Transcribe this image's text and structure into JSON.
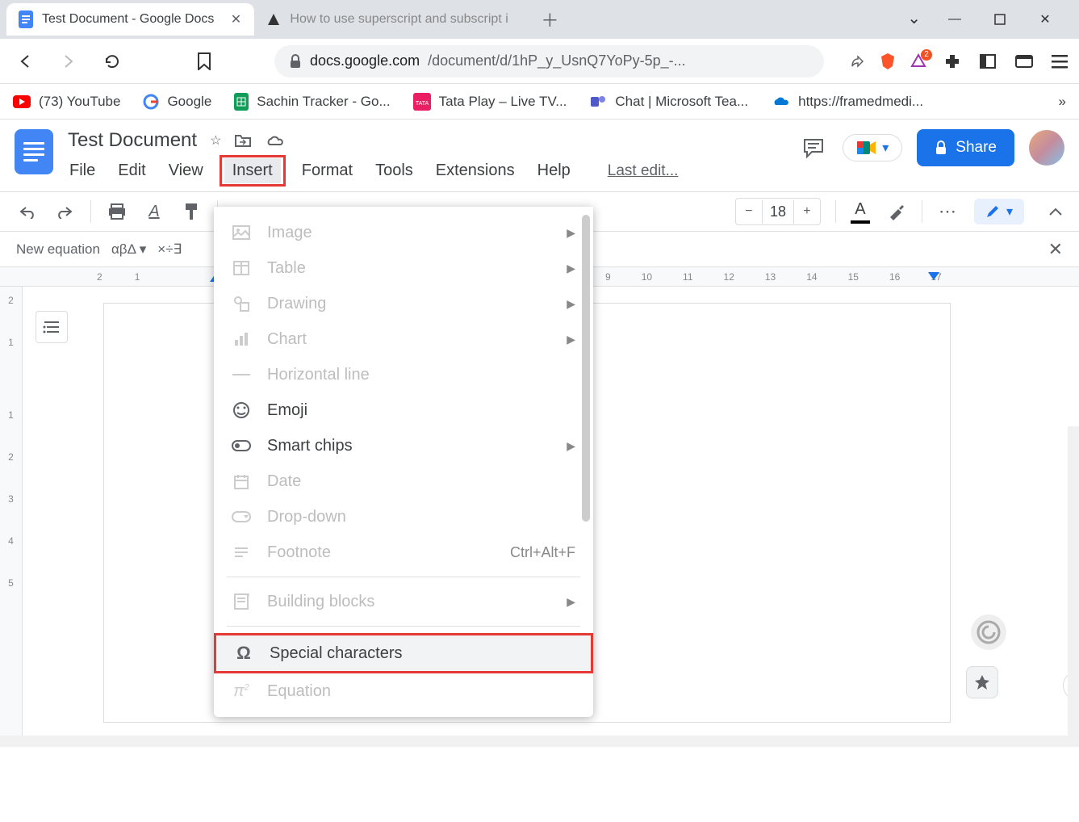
{
  "browser": {
    "tabs": [
      {
        "title": "Test Document - Google Docs",
        "active": true
      },
      {
        "title": "How to use superscript and subscript i",
        "active": false
      }
    ],
    "window_controls": {
      "minimize": "—",
      "maximize": "▢",
      "close": "✕"
    },
    "nav": {
      "back": "◁",
      "forward": "▷",
      "reload": "↻",
      "bookmark": "☆"
    },
    "url_lock": "🔒",
    "url_host": "docs.google.com",
    "url_path": "/document/d/1hP_y_UsnQ7YoPy-5p_-...",
    "share_icon": "↗",
    "brave_badge": "2",
    "bookmarks": [
      {
        "label": "(73) YouTube"
      },
      {
        "label": "Google"
      },
      {
        "label": "Sachin Tracker - Go..."
      },
      {
        "label": "Tata Play – Live TV..."
      },
      {
        "label": "Chat | Microsoft Tea..."
      },
      {
        "label": "https://framedmedi..."
      }
    ]
  },
  "docs": {
    "title": "Test Document",
    "menus": [
      "File",
      "Edit",
      "View",
      "Insert",
      "Format",
      "Tools",
      "Extensions",
      "Help"
    ],
    "active_menu": "Insert",
    "last_edit": "Last edit...",
    "share_label": "Share",
    "toolbar": {
      "font_size": "18",
      "minus": "−",
      "plus": "+",
      "text_color_letter": "A",
      "more": "⋯"
    },
    "equation_bar": {
      "label": "New equation",
      "greek": "αβΔ",
      "ops": "×÷∃"
    },
    "ruler_left": [
      "2",
      "1"
    ],
    "ruler_right": [
      "9",
      "10",
      "11",
      "12",
      "13",
      "14",
      "15",
      "16",
      "17"
    ],
    "vruler": [
      "2",
      "1",
      "",
      "1",
      "2",
      "3",
      "4",
      "5"
    ]
  },
  "insert_menu": [
    {
      "label": "Image",
      "icon": "image",
      "arrow": true,
      "disabled": true
    },
    {
      "label": "Table",
      "icon": "table",
      "arrow": true,
      "disabled": true
    },
    {
      "label": "Drawing",
      "icon": "drawing",
      "arrow": true,
      "disabled": true
    },
    {
      "label": "Chart",
      "icon": "chart",
      "arrow": true,
      "disabled": true
    },
    {
      "label": "Horizontal line",
      "icon": "hline",
      "disabled": true
    },
    {
      "label": "Emoji",
      "icon": "emoji"
    },
    {
      "label": "Smart chips",
      "icon": "chips",
      "arrow": true
    },
    {
      "label": "Date",
      "icon": "date",
      "disabled": true
    },
    {
      "label": "Drop-down",
      "icon": "dropdown",
      "disabled": true
    },
    {
      "label": "Footnote",
      "icon": "footnote",
      "shortcut": "Ctrl+Alt+F",
      "disabled": true
    },
    {
      "sep": true
    },
    {
      "label": "Building blocks",
      "icon": "blocks",
      "arrow": true,
      "disabled": true
    },
    {
      "sep": true
    },
    {
      "label": "Special characters",
      "icon": "omega",
      "hovered": true,
      "highlight": true
    },
    {
      "label": "Equation",
      "icon": "pi",
      "disabled": true
    }
  ]
}
